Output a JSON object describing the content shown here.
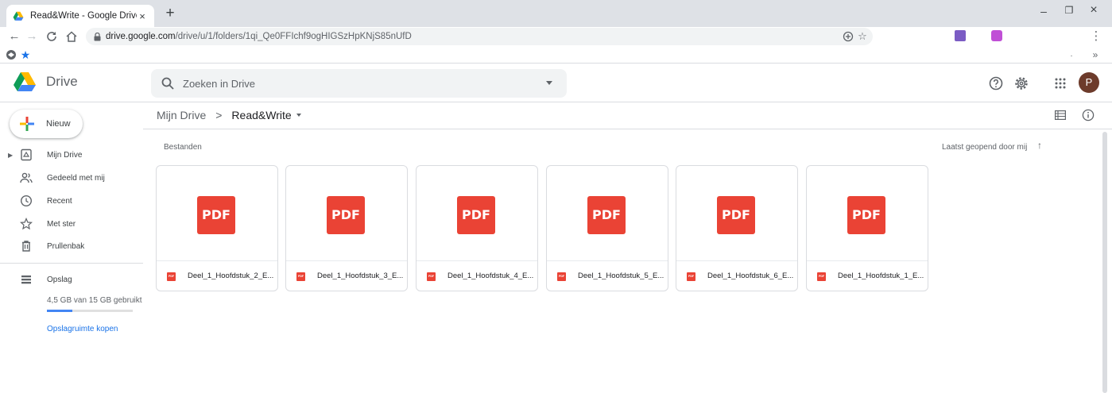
{
  "browser": {
    "tab_title": "Read&Write - Google Drive",
    "tab_close": "×",
    "new_tab": "+",
    "url_host": "drive.google.com",
    "url_path": "/drive/u/1/folders/1qi_Qe0FFIchf9ogHIGSzHpKNjS85nUfD",
    "minimize": "–",
    "restore": "❐",
    "close": "×",
    "menu": "⋮",
    "bookmarks_more": "»"
  },
  "drive": {
    "brand": "Drive",
    "search_placeholder": "Zoeken in Drive",
    "avatar_letter": "P",
    "new_button": "Nieuw",
    "sidebar": {
      "items": [
        {
          "label": "Mijn Drive"
        },
        {
          "label": "Gedeeld met mij"
        },
        {
          "label": "Recent"
        },
        {
          "label": "Met ster"
        },
        {
          "label": "Prullenbak"
        },
        {
          "label": "Opslag"
        }
      ],
      "storage_text": "4,5 GB van 15 GB gebruikt",
      "storage_fraction": 0.3,
      "buy_link": "Opslagruimte kopen"
    },
    "breadcrumb": {
      "root": "Mijn Drive",
      "separator": ">",
      "current": "Read&Write"
    },
    "section_title": "Bestanden",
    "sort_label": "Laatst geopend door mij",
    "sort_arrow": "↑",
    "files": [
      {
        "thumb": "PDF",
        "icon": "PDF",
        "name": "Deel_1_Hoofdstuk_2_E..."
      },
      {
        "thumb": "PDF",
        "icon": "PDF",
        "name": "Deel_1_Hoofdstuk_3_E..."
      },
      {
        "thumb": "PDF",
        "icon": "PDF",
        "name": "Deel_1_Hoofdstuk_4_E..."
      },
      {
        "thumb": "PDF",
        "icon": "PDF",
        "name": "Deel_1_Hoofdstuk_5_E..."
      },
      {
        "thumb": "PDF",
        "icon": "PDF",
        "name": "Deel_1_Hoofdstuk_6_E..."
      },
      {
        "thumb": "PDF",
        "icon": "PDF",
        "name": "Deel_1_Hoofdstuk_1_E..."
      }
    ]
  },
  "colors": {
    "accent": "#1a73e8",
    "pdf_red": "#ea4335",
    "avatar": "#6d3b2b"
  }
}
